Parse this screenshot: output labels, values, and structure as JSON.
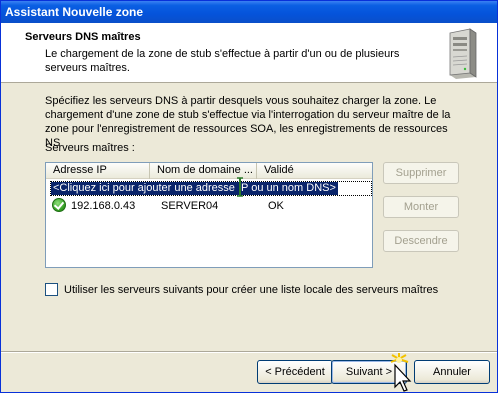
{
  "window": {
    "title": "Assistant Nouvelle zone"
  },
  "header": {
    "title": "Serveurs DNS maîtres",
    "description": "Le chargement de la zone de stub s'effectue à partir d'un ou de plusieurs serveurs maîtres.",
    "icon": "server-icon"
  },
  "body": {
    "intro": "Spécifiez les serveurs DNS à partir desquels vous souhaitez charger la zone. Le chargement d'une zone de stub s'effectue via l'interrogation du serveur maître de la zone pour l'enregistrement de ressources SOA, les enregistrements de ressources NS",
    "list_label": "Serveurs maîtres :",
    "columns": [
      "Adresse IP",
      "Nom de domaine ...",
      "Validé"
    ],
    "add_row": "<Cliquez ici pour ajouter une adresse IP ou un nom DNS>",
    "rows": [
      {
        "ip": "192.168.0.43",
        "name": "SERVER04",
        "valid": "OK",
        "icon": "ok-check-icon"
      }
    ],
    "buttons": {
      "delete": "Supprimer",
      "up": "Monter",
      "down": "Descendre"
    },
    "checkbox_label": "Utiliser les serveurs suivants pour créer une liste locale des serveurs maîtres",
    "checkbox_checked": false
  },
  "footer": {
    "back": "< Précédent",
    "next": "Suivant >",
    "cancel": "Annuler"
  },
  "colors": {
    "title_bar": "#0553da",
    "selection": "#0a246a",
    "window_bg": "#ece9d8"
  }
}
